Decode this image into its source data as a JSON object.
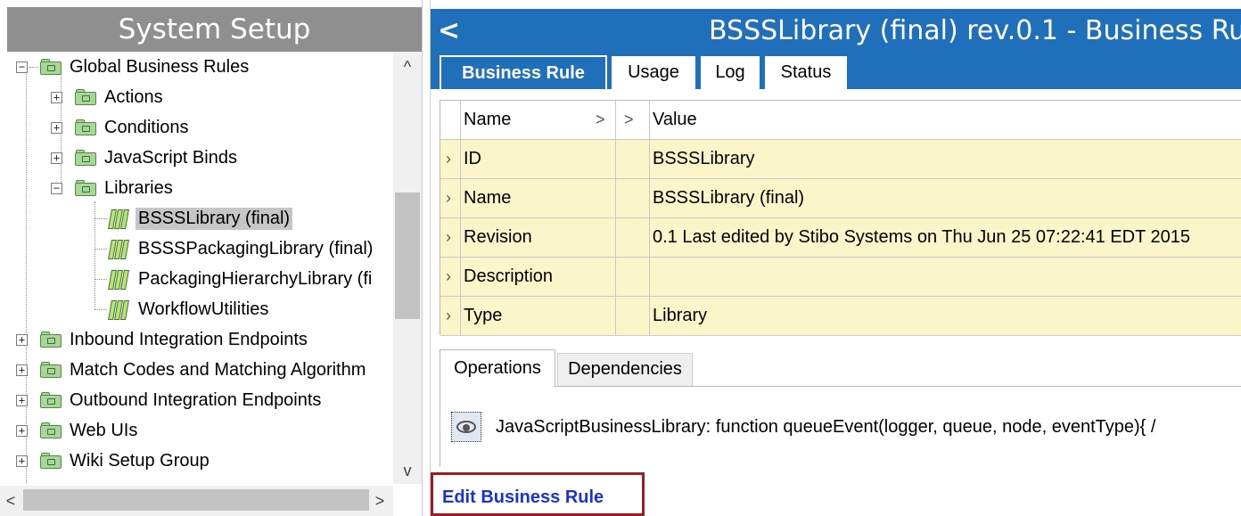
{
  "left_panel": {
    "title": "System Setup",
    "tree": [
      {
        "label": "Global Business Rules",
        "expander": "−",
        "icon": "folder-icon"
      },
      {
        "label": "Actions",
        "expander": "+",
        "icon": "folder-icon"
      },
      {
        "label": "Conditions",
        "expander": "+",
        "icon": "folder-icon"
      },
      {
        "label": "JavaScript Binds",
        "expander": "+",
        "icon": "folder-icon"
      },
      {
        "label": "Libraries",
        "expander": "−",
        "icon": "folder-icon"
      },
      {
        "label": "BSSSLibrary (final)",
        "icon": "library-icon",
        "selected": true
      },
      {
        "label": "BSSSPackagingLibrary (final)",
        "icon": "library-icon"
      },
      {
        "label": "PackagingHierarchyLibrary (fi",
        "icon": "library-icon"
      },
      {
        "label": "WorkflowUtilities",
        "icon": "library-icon"
      },
      {
        "label": "Inbound Integration Endpoints",
        "expander": "+",
        "icon": "folder-icon"
      },
      {
        "label": "Match Codes and Matching Algorithm",
        "expander": "+",
        "icon": "folder-icon"
      },
      {
        "label": "Outbound Integration Endpoints",
        "expander": "+",
        "icon": "folder-icon"
      },
      {
        "label": "Web UIs",
        "expander": "+",
        "icon": "folder-icon"
      },
      {
        "label": "Wiki Setup Group",
        "expander": "+",
        "icon": "folder-icon"
      }
    ],
    "scroll_up": "^",
    "scroll_down": "v",
    "scroll_left": "<",
    "scroll_right": ">"
  },
  "right_panel": {
    "back_glyph": "<",
    "title": "BSSSLibrary (final) rev.0.1 - Business Ru",
    "tabs": [
      "Business Rule",
      "Usage",
      "Log",
      "Status"
    ],
    "grid": {
      "header": {
        "name": "Name",
        "value": "Value",
        "chevron": ">"
      },
      "rows": [
        {
          "name": "ID",
          "value": "BSSSLibrary"
        },
        {
          "name": "Name",
          "value": "BSSSLibrary (final)"
        },
        {
          "name": "Revision",
          "value": "0.1 Last edited by Stibo Systems on Thu Jun 25 07:22:41 EDT 2015"
        },
        {
          "name": "Description",
          "value": ""
        },
        {
          "name": "Type",
          "value": "Library"
        }
      ]
    },
    "subtabs": [
      "Operations",
      "Dependencies"
    ],
    "operation_text": "JavaScriptBusinessLibrary: function queueEvent(logger, queue, node, eventType){  /",
    "edit_link": "Edit Business Rule"
  },
  "colors": {
    "accent": "#1f6fba",
    "highlight": "#9b1c24",
    "row_bg": "#fbf6c9",
    "link": "#1733d6"
  }
}
